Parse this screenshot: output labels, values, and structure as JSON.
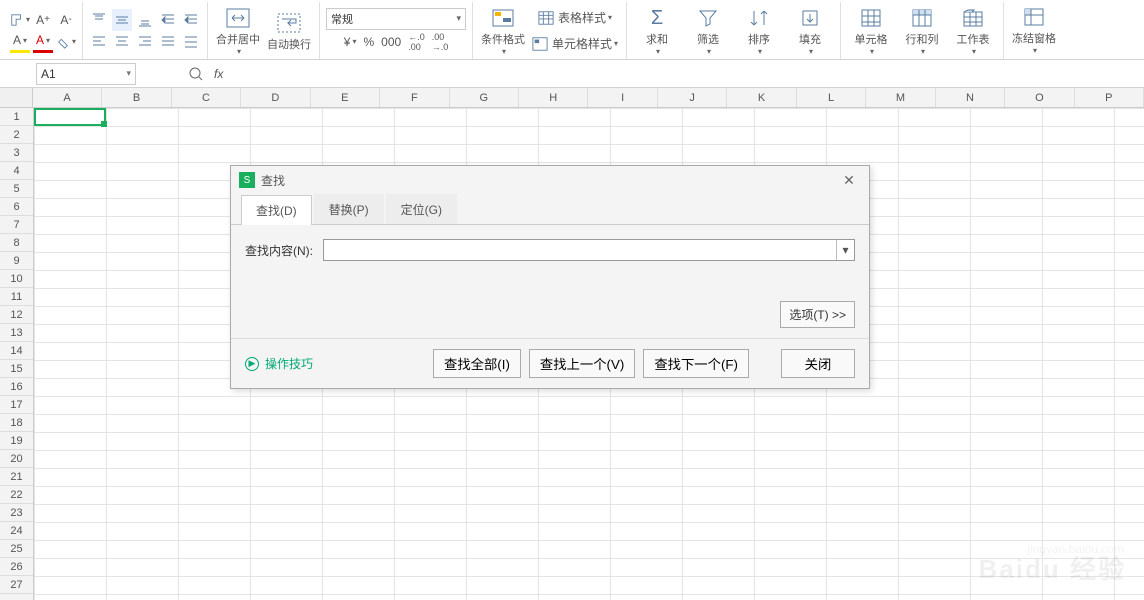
{
  "ribbon": {
    "format_combo": "常规",
    "merge": "合并居中",
    "wrap": "自动换行",
    "currency": "¥",
    "percent": "%",
    "comma": "000",
    "inc_dec1": "←0.0 .00",
    "inc_dec2": ".00 →0",
    "table_style": "表格样式",
    "cond_fmt": "条件格式",
    "cell_style": "单元格样式",
    "sum": "求和",
    "filter": "筛选",
    "sort": "排序",
    "fill": "填充",
    "cell": "单元格",
    "rowcol": "行和列",
    "worksheet": "工作表",
    "freeze": "冻结窗格"
  },
  "formula_bar": {
    "namebox": "A1",
    "fx": "fx"
  },
  "columns": [
    "A",
    "B",
    "C",
    "D",
    "E",
    "F",
    "G",
    "H",
    "I",
    "J",
    "K",
    "L",
    "M",
    "N",
    "O",
    "P"
  ],
  "dialog": {
    "title": "查找",
    "tabs": {
      "find": "查找(D)",
      "replace": "替换(P)",
      "goto": "定位(G)"
    },
    "find_label": "查找内容(N):",
    "find_value": "",
    "options": "选项(T) >>",
    "tips": "操作技巧",
    "find_all": "查找全部(I)",
    "find_prev": "查找上一个(V)",
    "find_next": "查找下一个(F)",
    "close": "关闭"
  },
  "watermark": {
    "line1": "Baidu 经验",
    "line2": "jingyan.baidu.com"
  }
}
